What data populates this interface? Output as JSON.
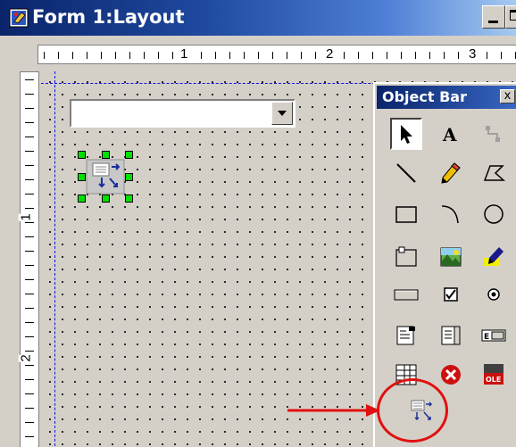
{
  "window": {
    "title": "Form 1:Layout"
  },
  "ruler": {
    "h_labels": [
      "1",
      "2",
      "3"
    ],
    "v_labels": [
      "1",
      "2"
    ]
  },
  "object_bar": {
    "title": "Object Bar",
    "close_label": "x"
  },
  "tools": [
    [
      "arrow-pointer-icon",
      "text-tool-icon",
      "connector-icon"
    ],
    [
      "line-icon",
      "pencil-icon",
      "polygon-icon"
    ],
    [
      "rectangle-icon",
      "arc-icon",
      "ellipse-icon"
    ],
    [
      "frame-icon",
      "picture-icon",
      "highlighter-icon"
    ],
    [
      "push-button-icon",
      "checkbox-icon",
      "radio-button-icon"
    ],
    [
      "list-field-icon",
      "list-box-icon",
      "edit-field-icon"
    ],
    [
      "table-field-icon",
      "cancel-icon",
      "ole-object-icon"
    ],
    [
      "subform-icon"
    ]
  ],
  "colors": {
    "annotation": "#e01010",
    "handle": "#00e000",
    "guide": "#1010e0"
  }
}
